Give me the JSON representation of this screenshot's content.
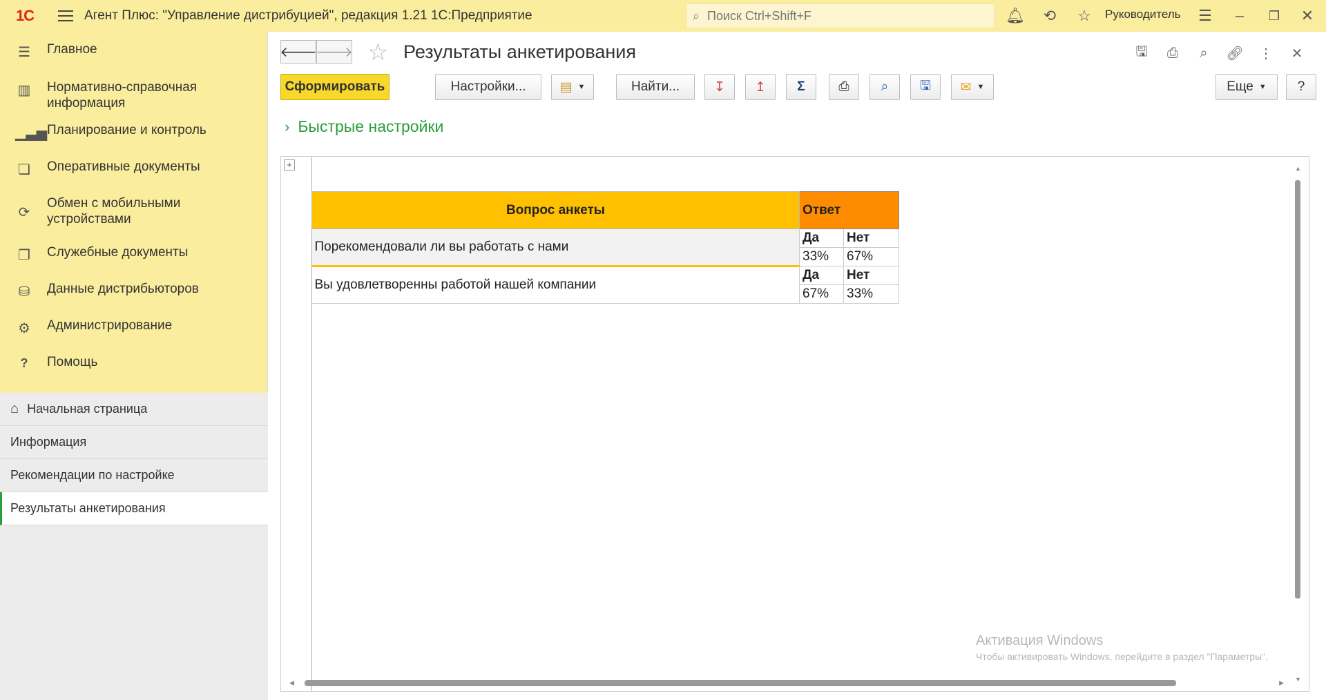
{
  "titlebar": {
    "logo": "1С",
    "title": "Агент Плюс: \"Управление дистрибуцией\", редакция 1.21 1С:Предприятие",
    "search_placeholder": "Поиск Ctrl+Shift+F",
    "user": "Руководитель"
  },
  "sidebar": {
    "items": [
      {
        "label": "Главное",
        "icon": "menu-icon"
      },
      {
        "label": "Нормативно-справочная информация",
        "icon": "catalog-icon"
      },
      {
        "label": "Планирование и контроль",
        "icon": "chart-icon"
      },
      {
        "label": "Оперативные документы",
        "icon": "documents-icon"
      },
      {
        "label": "Обмен с мобильными устройствами",
        "icon": "sync-icon"
      },
      {
        "label": "Служебные документы",
        "icon": "service-docs-icon"
      },
      {
        "label": "Данные дистрибьюторов",
        "icon": "distributors-icon"
      },
      {
        "label": "Администрирование",
        "icon": "gear-icon"
      },
      {
        "label": "Помощь",
        "icon": "help-icon"
      }
    ],
    "open_windows": [
      {
        "label": "Начальная страница",
        "icon": "home-icon"
      },
      {
        "label": "Информация"
      },
      {
        "label": "Рекомендации по настройке"
      },
      {
        "label": "Результаты анкетирования"
      }
    ]
  },
  "main": {
    "title": "Результаты анкетирования",
    "toolbar": {
      "generate": "Сформировать",
      "settings": "Настройки...",
      "find": "Найти...",
      "more": "Еще",
      "help": "?"
    },
    "quick_settings": "Быстрые настройки"
  },
  "report": {
    "header_question": "Вопрос анкеты",
    "header_answer": "Ответ",
    "rows": [
      {
        "question": "Порекомендовали ли вы работать с нами",
        "labels": [
          "Да",
          "Нет"
        ],
        "values": [
          "33%",
          "67%"
        ]
      },
      {
        "question": "Вы удовлетворенны работой нашей компании",
        "labels": [
          "Да",
          "Нет"
        ],
        "values": [
          "67%",
          "33%"
        ]
      }
    ]
  },
  "watermark": {
    "line1": "Активация Windows",
    "line2": "Чтобы активировать Windows, перейдите в раздел \"Параметры\"."
  },
  "colors": {
    "panel": "#fbed9e",
    "accent_green": "#2a9d3f",
    "header_yellow": "#ffc000",
    "header_orange": "#ff8c00",
    "primary_button": "#f7d82b"
  }
}
